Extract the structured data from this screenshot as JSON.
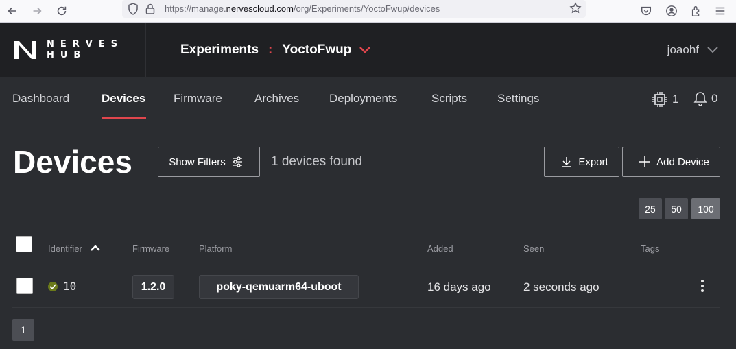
{
  "browser": {
    "url_prefix": "https://manage.",
    "url_domain": "nervescloud.com",
    "url_path": "/org/Experiments/YoctoFwup/devices"
  },
  "header": {
    "logo_top": "NERVES",
    "logo_bottom": "HUB",
    "org": "Experiments",
    "separator": ":",
    "product": "YoctoFwup",
    "user": "joaohf"
  },
  "tabs": [
    {
      "label": "Dashboard"
    },
    {
      "label": "Devices",
      "active": true
    },
    {
      "label": "Firmware"
    },
    {
      "label": "Archives"
    },
    {
      "label": "Deployments"
    },
    {
      "label": "Scripts"
    },
    {
      "label": "Settings"
    }
  ],
  "indicators": {
    "devices_count": "1",
    "alerts_count": "0"
  },
  "page": {
    "title": "Devices",
    "show_filters": "Show Filters",
    "found": "1 devices found",
    "export": "Export",
    "add_device": "Add Device"
  },
  "page_sizes": [
    "25",
    "50",
    "100"
  ],
  "table": {
    "headers": {
      "identifier": "Identifier",
      "firmware": "Firmware",
      "platform": "Platform",
      "added": "Added",
      "seen": "Seen",
      "tags": "Tags"
    },
    "rows": [
      {
        "identifier": "10",
        "firmware": "1.2.0",
        "platform": "poky-qemuarm64-uboot",
        "added": "16 days ago",
        "seen": "2 seconds ago",
        "status": "online"
      }
    ]
  },
  "pagination": {
    "current": "1"
  },
  "colors": {
    "accent": "#e0464d",
    "background": "#2b2d31",
    "header": "#1f2023"
  }
}
